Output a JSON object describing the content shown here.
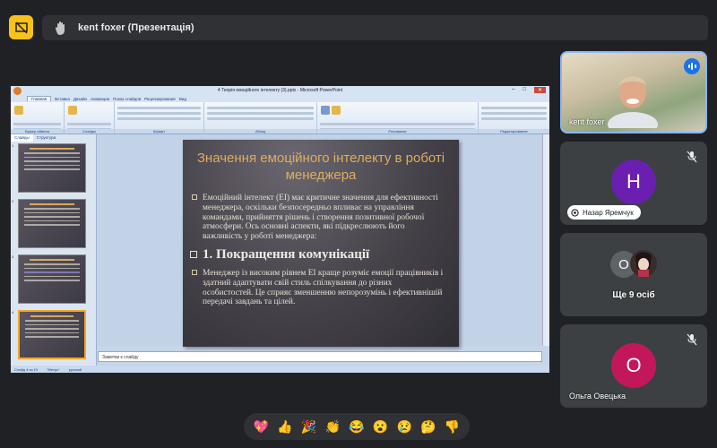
{
  "top": {
    "presenter_label": "kent foxer (Презентація)"
  },
  "powerpoint": {
    "window_title": "4 Теорія емоційного інтелекту (3).pptx - Microsoft PowerPoint",
    "tabs": [
      "Главная",
      "Вставка",
      "Дизайн",
      "Анимация",
      "Показ слайдов",
      "Рецензирование",
      "Вид"
    ],
    "ribbon_groups": [
      "Буфер обмена",
      "Слайды",
      "Шрифт",
      "Абзац",
      "Рисование",
      "Редактирование"
    ],
    "panel_tabs": [
      "Слайды",
      "Структура"
    ],
    "notes_placeholder": "Заметки к слайду",
    "status": [
      "Слайд 4 из 19",
      "\"Метро\"",
      "русский"
    ],
    "slide": {
      "title": "Значення емоційного інтелекту в роботі менеджера",
      "bullet1": "Емоційний інтелект (ЕІ) має критичне значення для ефективності менеджера, оскільки безпосередньо впливає на управління командами, прийняття рішень і створення позитивної робочої атмосфери. Ось основні аспекти, які підкреслюють його важливість у роботі менеджера:",
      "heading": "1. Покращення комунікації",
      "bullet2": "Менеджер із високим рівнем ЕІ краще розуміє емоції працівників і здатний адаптувати свій стиль спілкування до різних особистостей. Це сприяє зменшенню непорозумінь і ефективнішій передачі завдань та цілей."
    },
    "thumb_numbers": [
      "1",
      "2",
      "3",
      "4"
    ]
  },
  "participants": {
    "presenter_tile_name": "kent foxer",
    "tile2_initial": "Н",
    "tile2_name": "Назар Яремчук",
    "tile3_initial": "О",
    "tile3_more": "Ще 9 осіб",
    "tile4_initial": "О",
    "tile4_name": "Ольга Овецька"
  },
  "colors": {
    "avatar_n": "#6a1fb0",
    "avatar_o": "#c2185b",
    "highlight": "#f9c21a"
  },
  "reactions": [
    "💖",
    "👍",
    "🎉",
    "👏",
    "😂",
    "😮",
    "😢",
    "🤔",
    "👎"
  ]
}
